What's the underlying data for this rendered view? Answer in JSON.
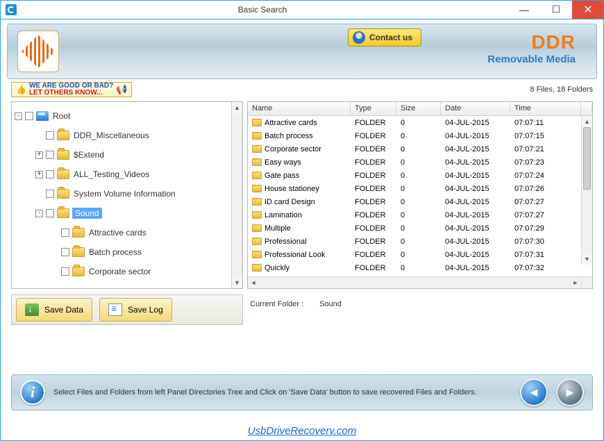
{
  "window": {
    "title": "Basic Search"
  },
  "header": {
    "contact_label": "Contact us",
    "brand": "DDR",
    "brand_sub": "Removable Media"
  },
  "rating": {
    "line1": "WE ARE GOOD OR BAD?",
    "line2": "LET OTHERS KNOW..."
  },
  "counts": "8 Files, 18 Folders",
  "tree": {
    "root": "Root",
    "items": [
      {
        "pm": "",
        "indent": 1,
        "label": "DDR_Miscellaneous"
      },
      {
        "pm": "+",
        "indent": 1,
        "label": "$Extend"
      },
      {
        "pm": "+",
        "indent": 1,
        "label": "ALL_Testing_Videos"
      },
      {
        "pm": "",
        "indent": 1,
        "label": "System Volume Information"
      },
      {
        "pm": "-",
        "indent": 1,
        "label": "Sound",
        "selected": true
      },
      {
        "pm": "",
        "indent": 2,
        "label": "Attractive cards"
      },
      {
        "pm": "",
        "indent": 2,
        "label": "Batch process"
      },
      {
        "pm": "",
        "indent": 2,
        "label": "Corporate sector"
      }
    ]
  },
  "buttons": {
    "save_data": "Save Data",
    "save_log": "Save Log"
  },
  "columns": {
    "name": "Name",
    "type": "Type",
    "size": "Size",
    "date": "Date",
    "time": "Time"
  },
  "rows": [
    {
      "name": "Attractive cards",
      "type": "FOLDER",
      "size": "0",
      "date": "04-JUL-2015",
      "time": "07:07:11"
    },
    {
      "name": "Batch process",
      "type": "FOLDER",
      "size": "0",
      "date": "04-JUL-2015",
      "time": "07:07:15"
    },
    {
      "name": "Corporate sector",
      "type": "FOLDER",
      "size": "0",
      "date": "04-JUL-2015",
      "time": "07:07:21"
    },
    {
      "name": "Easy ways",
      "type": "FOLDER",
      "size": "0",
      "date": "04-JUL-2015",
      "time": "07:07:23"
    },
    {
      "name": "Gate pass",
      "type": "FOLDER",
      "size": "0",
      "date": "04-JUL-2015",
      "time": "07:07:24"
    },
    {
      "name": "House stationey",
      "type": "FOLDER",
      "size": "0",
      "date": "04-JUL-2015",
      "time": "07:07:26"
    },
    {
      "name": "ID card Design",
      "type": "FOLDER",
      "size": "0",
      "date": "04-JUL-2015",
      "time": "07:07:27"
    },
    {
      "name": "Lamination",
      "type": "FOLDER",
      "size": "0",
      "date": "04-JUL-2015",
      "time": "07:07:27"
    },
    {
      "name": "Multiple",
      "type": "FOLDER",
      "size": "0",
      "date": "04-JUL-2015",
      "time": "07:07:29"
    },
    {
      "name": "Professional",
      "type": "FOLDER",
      "size": "0",
      "date": "04-JUL-2015",
      "time": "07:07:30"
    },
    {
      "name": "Professional Look",
      "type": "FOLDER",
      "size": "0",
      "date": "04-JUL-2015",
      "time": "07:07:31"
    },
    {
      "name": "Quickly",
      "type": "FOLDER",
      "size": "0",
      "date": "04-JUL-2015",
      "time": "07:07:32"
    }
  ],
  "current_folder": {
    "label": "Current Folder :",
    "value": "Sound"
  },
  "hint": "Select Files and Folders from left Panel Directories Tree and Click on 'Save Data' button to save recovered Files and Folders.",
  "footer_link": "UsbDriveRecovery.com"
}
